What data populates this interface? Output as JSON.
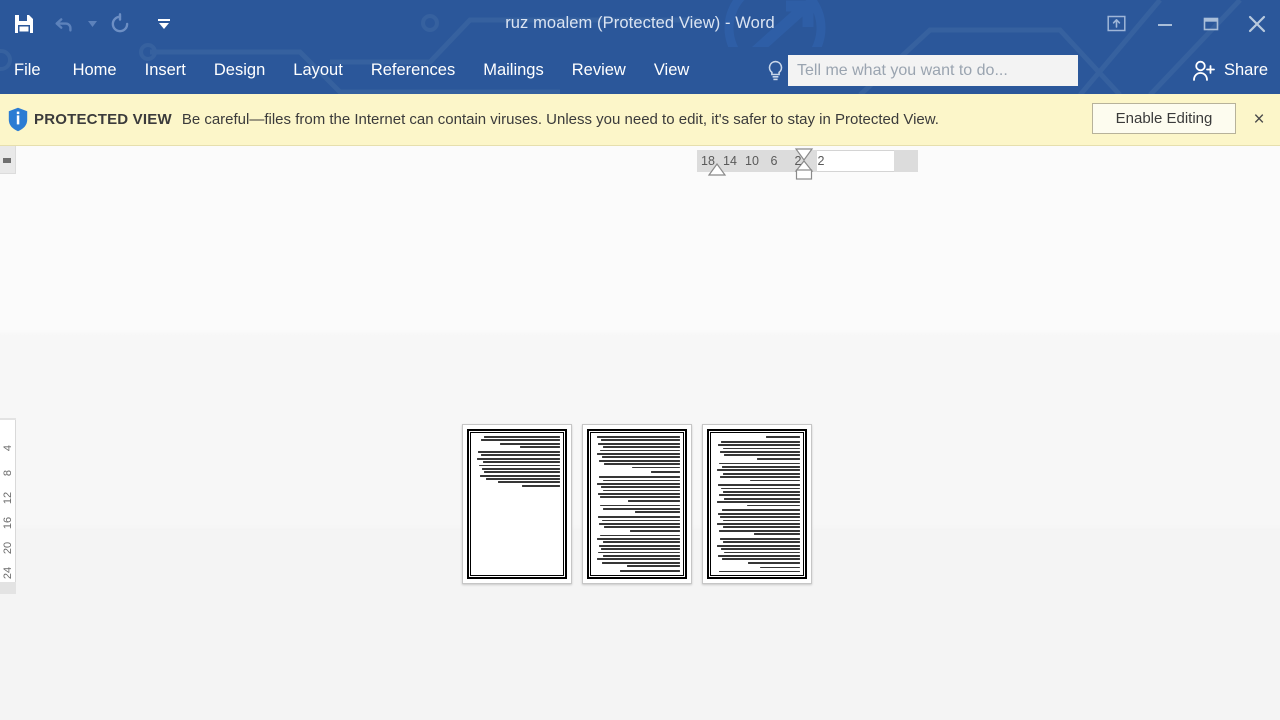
{
  "window": {
    "title": "ruz moalem (Protected View) - Word",
    "accent_color": "#2b579a",
    "controls": {
      "ribbon_display_options": "ribbon-display-options",
      "minimize": "minimize",
      "restore": "restore",
      "close": "close"
    }
  },
  "quick_access": {
    "save": "Save",
    "undo": "Undo",
    "undo_dropdown": "Undo options",
    "redo": "Redo",
    "customize": "Customize Quick Access Toolbar"
  },
  "ribbon": {
    "tabs": [
      {
        "label": "File",
        "active": false
      },
      {
        "label": "Home",
        "active": false
      },
      {
        "label": "Insert",
        "active": false
      },
      {
        "label": "Design",
        "active": false
      },
      {
        "label": "Layout",
        "active": false
      },
      {
        "label": "References",
        "active": false
      },
      {
        "label": "Mailings",
        "active": false
      },
      {
        "label": "Review",
        "active": false
      },
      {
        "label": "View",
        "active": false
      }
    ],
    "tell_me_placeholder": "Tell me what you want to do...",
    "tell_me_value": "",
    "share_label": "Share"
  },
  "protected_view": {
    "icon": "info-shield-icon",
    "label": "PROTECTED VIEW",
    "message": "Be careful—files from the Internet can contain viruses. Unless you need to edit, it's safer to stay in Protected View.",
    "enable_editing": "Enable Editing",
    "close": "×",
    "background_color": "#fcf6c9"
  },
  "rulers": {
    "horizontal_numbers": [
      "18",
      "14",
      "10",
      "6",
      "2",
      "2"
    ],
    "vertical_numbers": [
      "4",
      "8",
      "12",
      "16",
      "20",
      "24"
    ],
    "direction": "rtl"
  },
  "document": {
    "view_mode": "multiple-pages",
    "page_count": 3,
    "pages": [
      {
        "number": 1,
        "text_direction": "rtl",
        "paragraphs": [
          [
            88,
            92,
            70,
            46
          ],
          [
            95,
            92,
            96,
            90,
            94,
            91,
            88,
            93,
            86,
            72,
            44
          ]
        ]
      },
      {
        "number": 2,
        "text_direction": "rtl",
        "paragraphs": [
          [
            96,
            92,
            95,
            90,
            93,
            96,
            91,
            94,
            88,
            56
          ],
          [
            34
          ],
          [
            94,
            90,
            96,
            92,
            89,
            95,
            93,
            60
          ],
          [
            93,
            90,
            52
          ],
          [
            95,
            91,
            94,
            88,
            58
          ],
          [
            93,
            96,
            90,
            94,
            92,
            95,
            89,
            96,
            91,
            62
          ],
          [
            70,
            20
          ]
        ]
      },
      {
        "number": 3,
        "text_direction": "rtl",
        "paragraphs": [
          [
            40
          ],
          [
            92,
            95,
            90,
            93,
            88,
            50
          ],
          [
            94,
            91,
            96,
            89,
            93,
            58
          ],
          [
            95,
            92,
            90,
            94,
            88,
            96,
            62
          ],
          [
            91,
            95,
            93,
            89,
            96,
            90,
            94,
            54
          ],
          [
            93,
            90,
            96,
            92,
            88,
            95,
            91,
            60
          ],
          [
            46
          ],
          [
            94,
            90,
            66
          ]
        ]
      }
    ]
  }
}
